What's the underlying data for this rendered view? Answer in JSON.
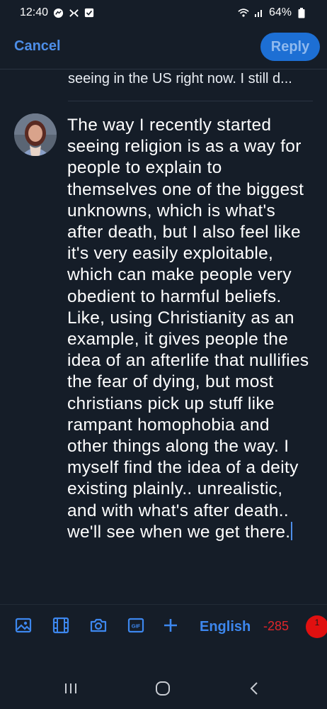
{
  "status_bar": {
    "time": "12:40",
    "battery": "64%"
  },
  "header": {
    "cancel_label": "Cancel",
    "reply_label": "Reply"
  },
  "quote": {
    "text": "seeing in the US right now. I still d..."
  },
  "composer": {
    "text": "The way I recently started seeing religion is as a way for people to explain to themselves one of the biggest unknowns, which is what's after death, but I also feel like it's very easily exploitable, which can make people very obedient to harmful beliefs. Like, using Christianity as an example, it gives people the idea of an afterlife that nullifies the fear of dying, but most christians pick up stuff like rampant homophobia and other things along the way. I myself find the idea of a deity existing plainly.. unrealistic, and with what's after death.. we'll see when we get there."
  },
  "toolbar": {
    "icons": [
      "image-icon",
      "video-icon",
      "camera-icon",
      "gif-icon",
      "plus-icon"
    ],
    "gif_label": "GIF",
    "language": "English",
    "char_count": "-285",
    "badge_count": "1"
  },
  "colors": {
    "background": "#151d28",
    "accent": "#4d8ee8",
    "reply_button": "#1d6fd4",
    "error": "#e0262a"
  }
}
